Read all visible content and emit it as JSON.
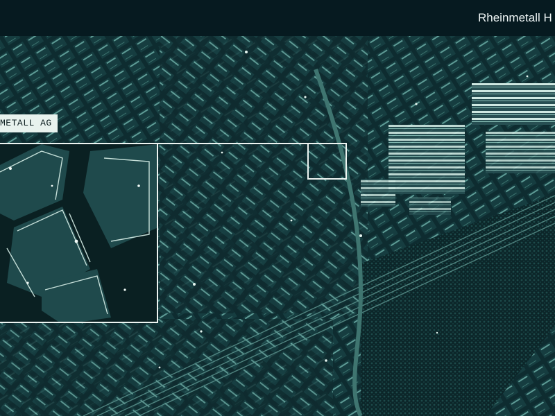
{
  "header": {
    "brand": "Rheinmetall H"
  },
  "map": {
    "target_label": "METALL AG",
    "icon": "satellite-map-icon"
  },
  "colors": {
    "header_bg": "#061a20",
    "map_bg": "#0d2a2e",
    "highlight": "#eef5f2",
    "building_glow": "#cfe9e2"
  }
}
